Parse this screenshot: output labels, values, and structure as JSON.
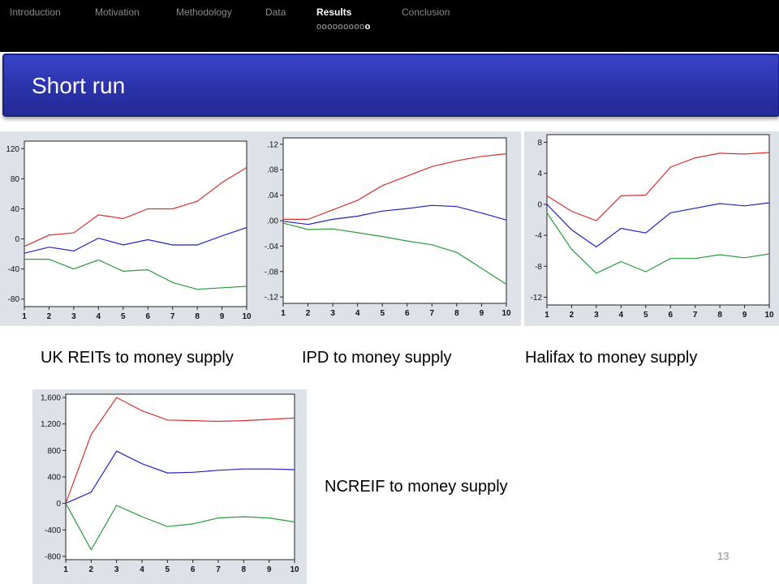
{
  "nav": {
    "items": [
      "Introduction",
      "Motivation",
      "Methodology",
      "Data",
      "Results",
      "Conclusion"
    ],
    "active": "Results",
    "progress_dots": "ooooooooo",
    "progress_current": "o"
  },
  "slide": {
    "title": "Short run",
    "page_number": "13"
  },
  "captions": {
    "uk_reits": "UK REITs to money supply",
    "ipd": "IPD to money supply",
    "halifax": "Halifax to money supply",
    "ncreif": "NCREIF to money supply"
  },
  "colors": {
    "upper": "#d93030",
    "response": "#2222c0",
    "lower": "#2a9a3a"
  },
  "chart_data": [
    {
      "id": "uk_reits",
      "type": "line",
      "x": [
        1,
        2,
        3,
        4,
        5,
        6,
        7,
        8,
        9,
        10
      ],
      "ylim": [
        -90,
        130
      ],
      "yticks": [
        -80,
        -40,
        0,
        40,
        80,
        120
      ],
      "ytick_labels": [
        "-80",
        "-40",
        "0",
        "40",
        "80",
        "120"
      ],
      "series": [
        {
          "key": "upper",
          "values": [
            -10,
            5,
            8,
            32,
            27,
            40,
            40,
            50,
            75,
            95
          ]
        },
        {
          "key": "response",
          "values": [
            -19,
            -11,
            -16,
            1,
            -8,
            -1,
            -8,
            -8,
            4,
            15
          ]
        },
        {
          "key": "lower",
          "values": [
            -27,
            -27,
            -40,
            -28,
            -43,
            -41,
            -58,
            -67,
            -65,
            -63
          ]
        }
      ]
    },
    {
      "id": "ipd",
      "type": "line",
      "x": [
        1,
        2,
        3,
        4,
        5,
        6,
        7,
        8,
        9,
        10
      ],
      "ylim": [
        -0.13,
        0.13
      ],
      "yticks": [
        -0.12,
        -0.08,
        -0.04,
        0,
        0.04,
        0.08,
        0.12
      ],
      "ytick_labels": [
        "-.12",
        "-.08",
        "-.04",
        ".00",
        ".04",
        ".08",
        ".12"
      ],
      "series": [
        {
          "key": "upper",
          "values": [
            0.002,
            0.002,
            0.017,
            0.032,
            0.055,
            0.07,
            0.085,
            0.094,
            0.101,
            0.105
          ]
        },
        {
          "key": "response",
          "values": [
            -0.001,
            -0.006,
            0.002,
            0.007,
            0.015,
            0.019,
            0.024,
            0.022,
            0.012,
            0.001
          ]
        },
        {
          "key": "lower",
          "values": [
            -0.004,
            -0.014,
            -0.013,
            -0.019,
            -0.025,
            -0.032,
            -0.038,
            -0.05,
            -0.075,
            -0.1
          ]
        }
      ]
    },
    {
      "id": "halifax",
      "type": "line",
      "x": [
        1,
        2,
        3,
        4,
        5,
        6,
        7,
        8,
        9,
        10
      ],
      "ylim": [
        -13,
        9
      ],
      "yticks": [
        -12,
        -8,
        -4,
        0,
        4,
        8
      ],
      "ytick_labels": [
        "-12",
        "-8",
        "-4",
        "0",
        "4",
        "8"
      ],
      "series": [
        {
          "key": "upper",
          "values": [
            1.1,
            -0.9,
            -2.1,
            1.1,
            1.2,
            4.8,
            6.0,
            6.6,
            6.5,
            6.7
          ]
        },
        {
          "key": "response",
          "values": [
            0.0,
            -3.3,
            -5.5,
            -3.1,
            -3.7,
            -1.1,
            -0.5,
            0.1,
            -0.2,
            0.2
          ]
        },
        {
          "key": "lower",
          "values": [
            -1.1,
            -5.8,
            -8.9,
            -7.4,
            -8.7,
            -7.0,
            -7.0,
            -6.5,
            -6.9,
            -6.4
          ]
        }
      ]
    },
    {
      "id": "ncreif",
      "type": "line",
      "x": [
        1,
        2,
        3,
        4,
        5,
        6,
        7,
        8,
        9,
        10
      ],
      "ylim": [
        -850,
        1650
      ],
      "yticks": [
        -800,
        -400,
        0,
        400,
        800,
        1200,
        1600
      ],
      "ytick_labels": [
        "-800",
        "-400",
        "0",
        "400",
        "800",
        "1,200",
        "1,600"
      ],
      "series": [
        {
          "key": "upper",
          "values": [
            0,
            1040,
            1600,
            1400,
            1260,
            1250,
            1240,
            1250,
            1270,
            1290
          ]
        },
        {
          "key": "response",
          "values": [
            0,
            170,
            790,
            600,
            460,
            470,
            500,
            520,
            520,
            510
          ]
        },
        {
          "key": "lower",
          "values": [
            0,
            -700,
            -30,
            -200,
            -350,
            -310,
            -220,
            -200,
            -220,
            -280
          ]
        }
      ]
    }
  ]
}
